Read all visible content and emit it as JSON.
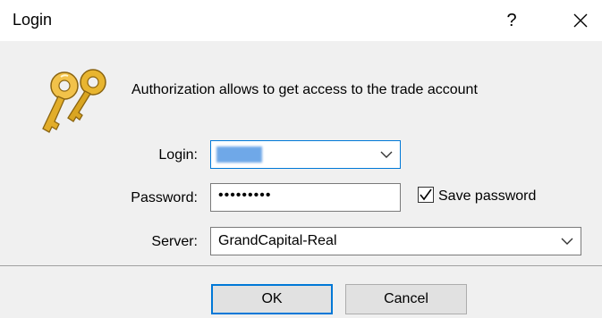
{
  "window": {
    "title": "Login",
    "help_label": "?"
  },
  "message": "Authorization allows to get access to the trade account",
  "form": {
    "login_label": "Login:",
    "login_value": "00000",
    "password_label": "Password:",
    "password_value": "•••••••••",
    "save_password_label": "Save password",
    "save_password_checked": true,
    "server_label": "Server:",
    "server_value": "GrandCapital-Real"
  },
  "buttons": {
    "ok_label": "OK",
    "cancel_label": "Cancel"
  },
  "colors": {
    "accent": "#0078d7",
    "selection": "#6fa8e8",
    "key_gold": "#d9a521"
  },
  "icons": {
    "keys": "keys-icon",
    "close": "close-icon",
    "dropdown": "chevron-down-icon",
    "check": "checkmark-icon"
  }
}
